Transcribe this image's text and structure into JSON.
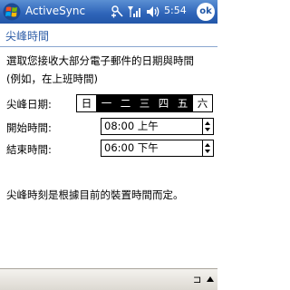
{
  "titlebar": {
    "app_title": "ActiveSync",
    "time": "5:54",
    "ok_label": "ok"
  },
  "section": {
    "title": "尖峰時間"
  },
  "instructions": {
    "line1": "選取您接收大部分電子郵件的日期與時間",
    "line2": "(例如，在上班時間)"
  },
  "peak_days": {
    "label": "尖峰日期:",
    "days": [
      {
        "label": "日",
        "selected": false
      },
      {
        "label": "一",
        "selected": true
      },
      {
        "label": "二",
        "selected": true
      },
      {
        "label": "三",
        "selected": true
      },
      {
        "label": "四",
        "selected": true
      },
      {
        "label": "五",
        "selected": true
      },
      {
        "label": "六",
        "selected": false
      }
    ]
  },
  "start_time": {
    "label": "開始時間:",
    "value": "08:00 上午"
  },
  "end_time": {
    "label": "結束時間:",
    "value": "06:00 下午"
  },
  "note": "尖峰時刻是根據目前的裝置時間而定。",
  "colors": {
    "title_bar": "#2d63b8",
    "section_header": "#2e5ea8"
  }
}
